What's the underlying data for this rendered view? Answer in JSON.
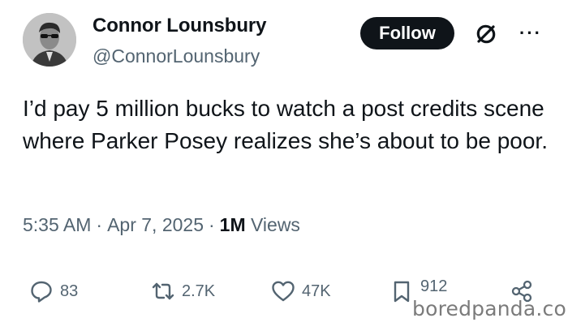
{
  "author": {
    "name": "Connor Lounsbury",
    "handle": "@ConnorLounsbury"
  },
  "follow_label": "Follow",
  "more_label": "···",
  "tweet": {
    "text": "I’d pay 5 million bucks to watch a post credits scene where Parker Posey realizes she’s about to be poor."
  },
  "meta": {
    "time": "5:35 AM",
    "date": "Apr 7, 2025",
    "views_count": "1M",
    "views_label": "Views"
  },
  "actions": {
    "replies": "83",
    "reposts": "2.7K",
    "likes": "47K",
    "bookmarks": "912"
  },
  "icons": {
    "grok": "grok-icon",
    "reply": "reply-icon",
    "repost": "repost-icon",
    "like": "heart-icon",
    "bookmark": "bookmark-icon",
    "share": "share-icon"
  },
  "watermark": "boredpanda.com"
}
